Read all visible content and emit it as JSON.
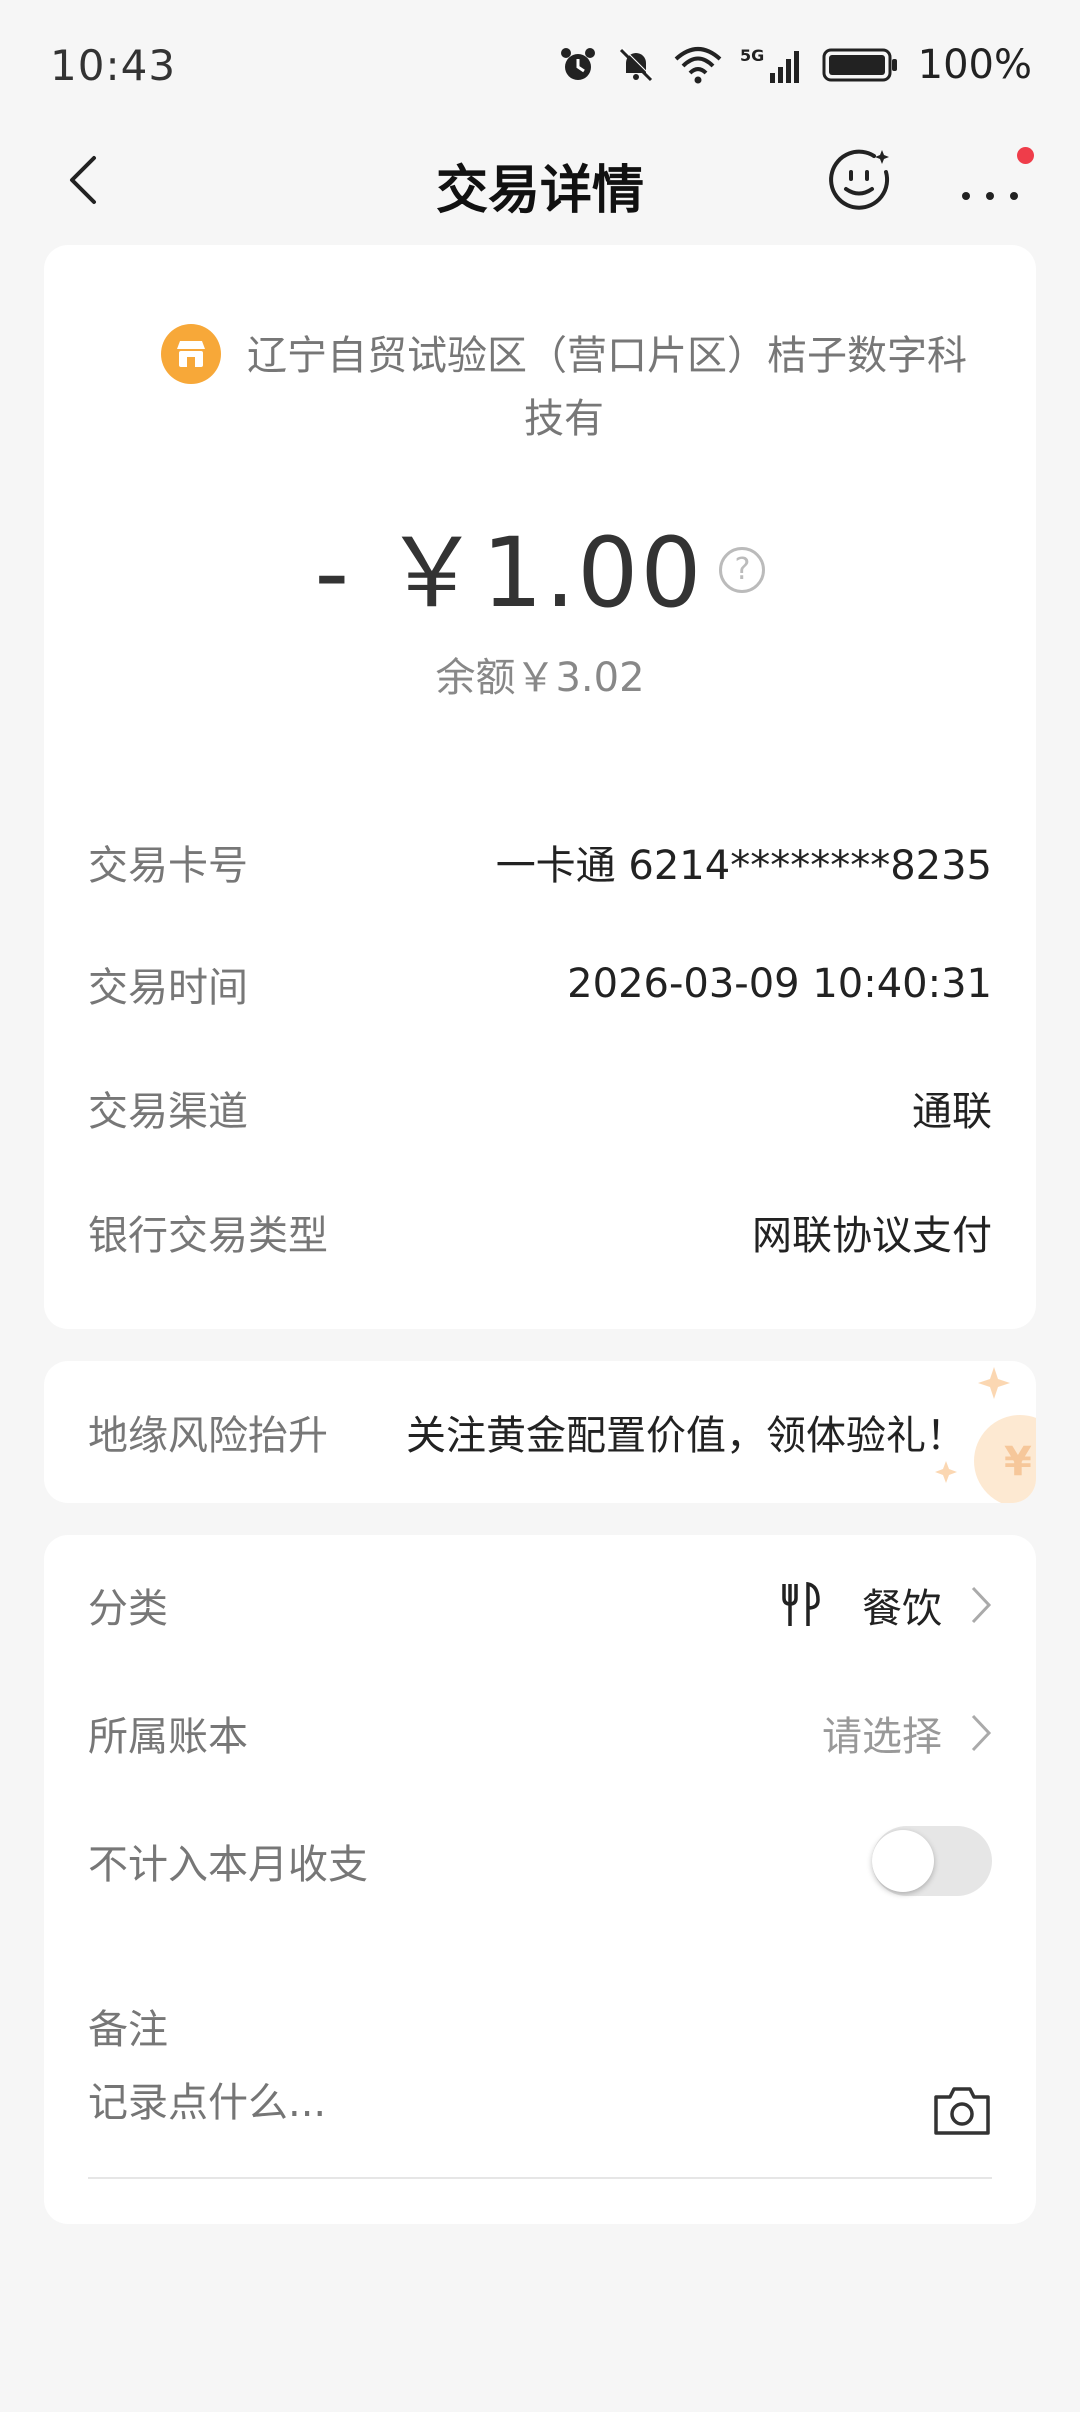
{
  "status_bar": {
    "time": "10:43",
    "battery": "100%",
    "network": "5G"
  },
  "nav": {
    "title": "交易详情"
  },
  "transaction": {
    "merchant": "辽宁自贸试验区（营口片区）桔子数字科技有",
    "amount": "- ￥1.00",
    "help_glyph": "?",
    "balance": "余额￥3.02",
    "details": [
      {
        "label": "交易卡号",
        "value": "一卡通 6214********8235"
      },
      {
        "label": "交易时间",
        "value": "2026-03-09 10:40:31"
      },
      {
        "label": "交易渠道",
        "value": "通联"
      },
      {
        "label": "银行交易类型",
        "value": "网联协议支付"
      }
    ]
  },
  "ad": {
    "label": "地缘风险抬升",
    "text": "关注黄金配置价值，领体验礼！"
  },
  "extra": {
    "category_label": "分类",
    "category_value": "餐饮",
    "ledger_label": "所属账本",
    "ledger_value": "请选择",
    "exclude_label": "不计入本月收支",
    "exclude_on": false,
    "remark_label": "备注",
    "remark_placeholder": "记录点什么..."
  },
  "colors": {
    "accent": "#f7a839",
    "notification": "#ef3d4a",
    "background": "#f6f6f6"
  }
}
